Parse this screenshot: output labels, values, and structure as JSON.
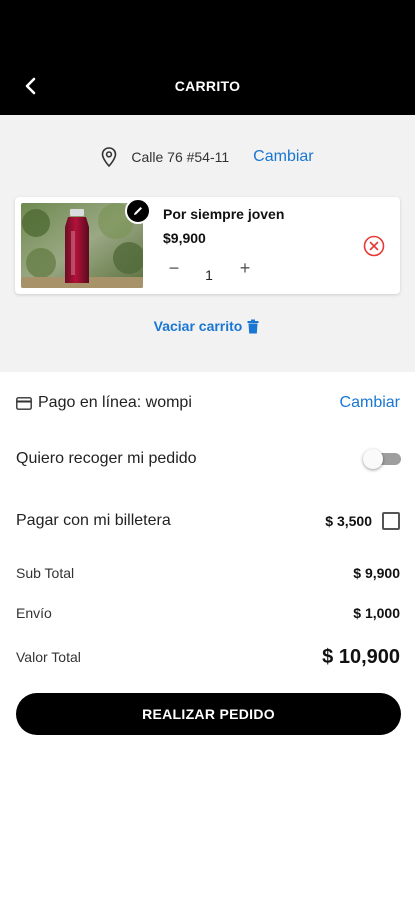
{
  "header": {
    "title": "CARRITO",
    "back_icon": "chevron-left-icon"
  },
  "address": {
    "icon": "location-pin-icon",
    "text": "Calle 76 #54-11",
    "change_label": "Cambiar"
  },
  "cart": {
    "items": [
      {
        "name": "Por siempre joven",
        "price": "$9,900",
        "quantity": "1",
        "minus_label": "−",
        "plus_label": "+",
        "image": "bottle-red-juice-photo",
        "edit_icon": "pencil-icon",
        "remove_icon": "close-circle-icon"
      }
    ],
    "empty_label": "Vaciar carrito",
    "empty_icon": "trash-icon"
  },
  "payment": {
    "icon": "credit-card-icon",
    "label": "Pago en línea: wompi",
    "change_label": "Cambiar"
  },
  "pickup": {
    "label": "Quiero recoger mi pedido",
    "enabled": false
  },
  "wallet": {
    "label": "Pagar con mi billetera",
    "amount": "$ 3,500",
    "checked": false
  },
  "summary": {
    "subtotal_label": "Sub Total",
    "subtotal_value": "$ 9,900",
    "shipping_label": "Envío",
    "shipping_value": "$ 1,000",
    "total_label": "Valor Total",
    "total_value": "$ 10,900"
  },
  "order_button": {
    "label": "REALIZAR PEDIDO"
  },
  "colors": {
    "accent": "#1976d2",
    "header_bg": "#000000",
    "remove_red": "#e53935"
  }
}
